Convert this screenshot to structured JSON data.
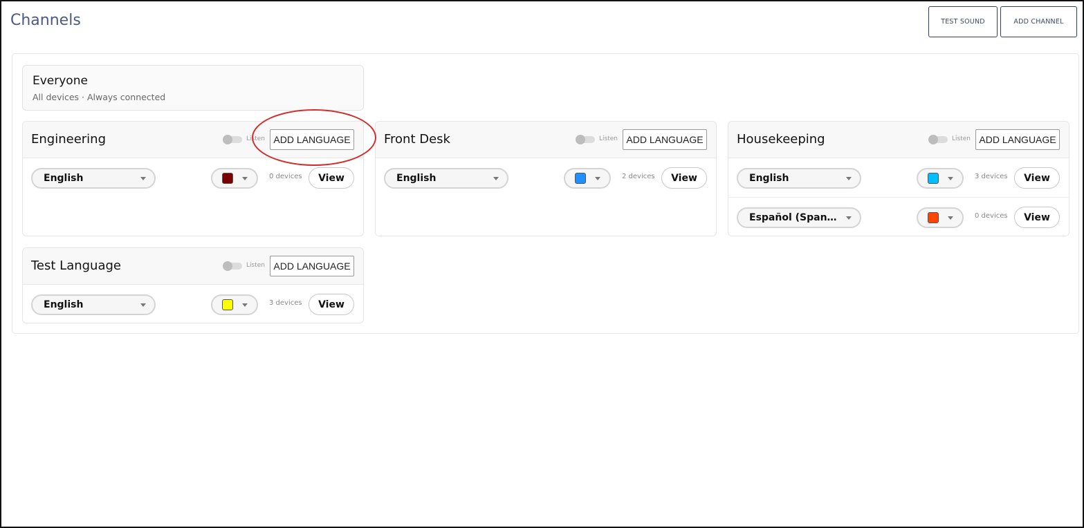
{
  "header": {
    "title": "Channels",
    "test_sound_label": "TEST SOUND",
    "add_channel_label": "ADD CHANNEL"
  },
  "everyone": {
    "title": "Everyone",
    "subtitle": "All devices · Always connected"
  },
  "channels": [
    {
      "name": "Engineering",
      "listen_label": "Listen",
      "add_language_label": "ADD LANGUAGE",
      "languages": [
        {
          "language": "English",
          "color": "#7a0000",
          "devices": "0 devices",
          "view_label": "View"
        }
      ]
    },
    {
      "name": "Front Desk",
      "listen_label": "Listen",
      "add_language_label": "ADD LANGUAGE",
      "languages": [
        {
          "language": "English",
          "color": "#1e90ff",
          "devices": "2 devices",
          "view_label": "View"
        }
      ]
    },
    {
      "name": "Housekeeping",
      "listen_label": "Listen",
      "add_language_label": "ADD LANGUAGE",
      "languages": [
        {
          "language": "English",
          "color": "#00bfff",
          "devices": "3 devices",
          "view_label": "View"
        },
        {
          "language": "Español (Span...",
          "color": "#ff4500",
          "devices": "0 devices",
          "view_label": "View"
        }
      ]
    },
    {
      "name": "Test Language",
      "listen_label": "Listen",
      "add_language_label": "ADD LANGUAGE",
      "languages": [
        {
          "language": "English",
          "color": "#ffff00",
          "devices": "3 devices",
          "view_label": "View"
        }
      ]
    }
  ],
  "colors": {
    "title": "#4a5a85",
    "annotation": "#d42a2a"
  }
}
